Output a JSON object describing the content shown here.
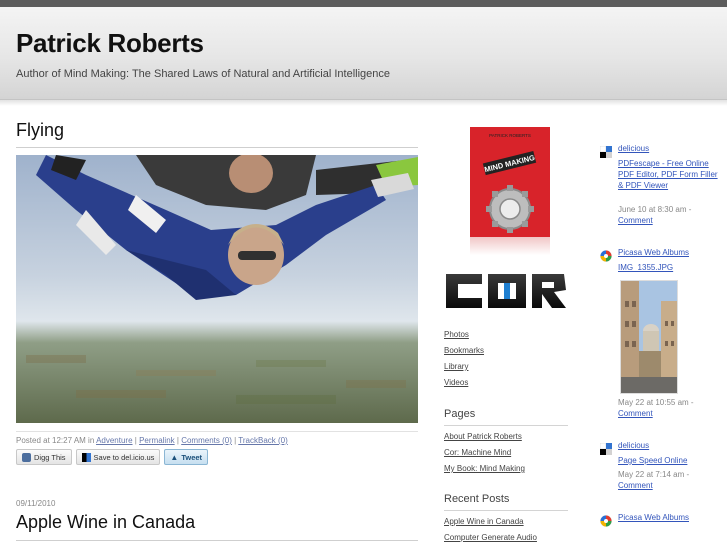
{
  "header": {
    "title": "Patrick Roberts",
    "tagline": "Author of Mind Making: The Shared Laws of Natural and Artificial Intelligence"
  },
  "post1": {
    "title": "Flying",
    "meta_prefix": "Posted at 12:27 AM in",
    "category": "Adventure",
    "permalink": "Permalink",
    "comments": "Comments (0)",
    "trackback": "TrackBack (0)",
    "sep": "|"
  },
  "share": {
    "digg": "Digg This",
    "delicious": "Save to del.icio.us",
    "tweet": "Tweet"
  },
  "post2": {
    "date": "09/11/2010",
    "title": "Apple Wine in Canada"
  },
  "sidebar": {
    "book_cover_title": "MIND MAKING",
    "book_cover_author": "PATRICK ROBERTS",
    "links": [
      "Photos",
      "Bookmarks",
      "Library",
      "Videos"
    ],
    "pages_heading": "Pages",
    "pages": [
      "About Patrick Roberts",
      "Cor: Machine Mind",
      "My Book: Mind Making"
    ],
    "recent_heading": "Recent Posts",
    "recent": [
      "Apple Wine in Canada",
      "Computer Generate Audio"
    ]
  },
  "feed": [
    {
      "source": "delicious",
      "title": "PDFescape - Free Online PDF Editor, PDF Form Filler & PDF Viewer",
      "when": "June 10 at 8:30 am -",
      "comment": "Comment",
      "icon": "delicious-icon"
    },
    {
      "source": "Picasa Web Albums",
      "title": "IMG_1355.JPG",
      "when": "May 22 at 10:55 am -",
      "comment": "Comment",
      "icon": "picasa-icon"
    },
    {
      "source": "delicious",
      "title": "Page Speed Online",
      "when": "May 22 at 7:14 am -",
      "comment": "Comment",
      "icon": "delicious-icon"
    },
    {
      "source": "Picasa Web Albums",
      "icon": "picasa-icon"
    }
  ],
  "colors": {
    "link": "#3355bb",
    "book_red": "#d8232a",
    "top_strip": "#5c5c5c"
  }
}
